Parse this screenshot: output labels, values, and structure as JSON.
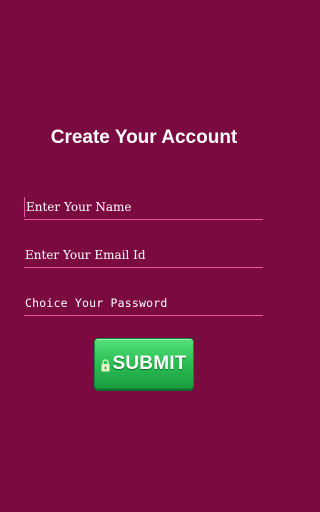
{
  "header": {
    "title": "Create Your Account"
  },
  "form": {
    "name_placeholder": "Enter Your Name",
    "email_placeholder": "Enter Your Email Id",
    "password_placeholder": "Choice Your Password",
    "name_value": "",
    "email_value": "",
    "password_value": ""
  },
  "submit": {
    "label": "SUBMIT",
    "icon": "lock-icon"
  },
  "colors": {
    "background": "#7a0a40",
    "accent_underline": "#e8569c",
    "button_green": "#2dc257"
  }
}
